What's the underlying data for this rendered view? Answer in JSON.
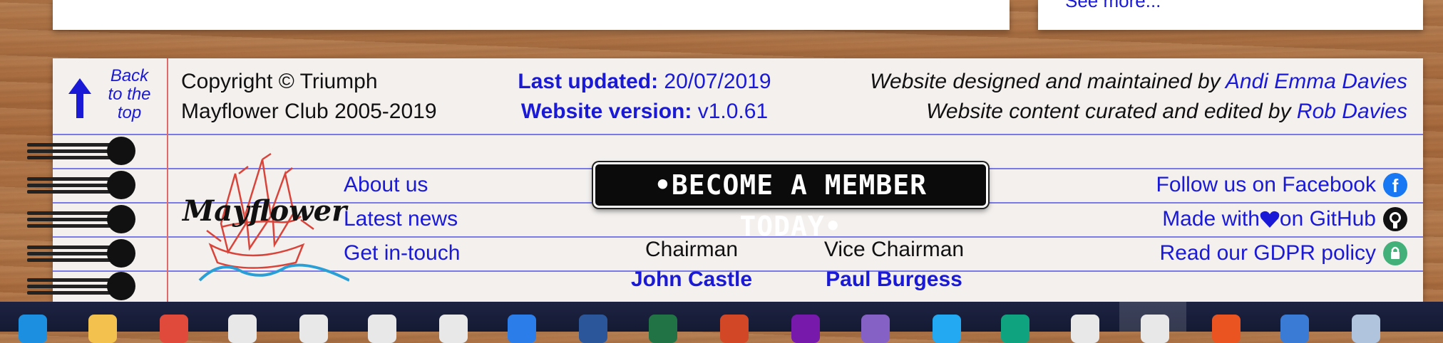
{
  "top_cards": {
    "see_more": "See more..."
  },
  "footer": {
    "back_to_top": {
      "line1": "Back",
      "line2": "to the",
      "line3": "top"
    },
    "copyright": {
      "line1": "Copyright © Triumph",
      "line2": "Mayflower Club 2005-2019"
    },
    "last_updated": {
      "label": "Last updated:",
      "value": "20/07/2019"
    },
    "website_version": {
      "label": "Website version:",
      "value": "v1.0.61"
    },
    "credits": {
      "designed_prefix": "Website designed and maintained by ",
      "designed_name": "Andi Emma Davies",
      "content_prefix": "Website content curated and edited by ",
      "content_name": "Rob Davies"
    },
    "logo_text": "Mayflower",
    "nav_links": [
      "About us",
      "Latest news",
      "Get in-touch"
    ],
    "member_button": "•BECOME A MEMBER TODAY•",
    "officers": {
      "chairman_title": "Chairman",
      "chairman_name": "John Castle",
      "vice_title": "Vice Chairman",
      "vice_name": "Paul Burgess"
    },
    "social": {
      "facebook": "Follow us on Facebook",
      "github_prefix": "Made with ",
      "github_suffix": " on GitHub",
      "gdpr": "Read our GDPR policy"
    }
  },
  "taskbar": {
    "icons": [
      "edge-icon",
      "file-explorer-icon",
      "store-icon",
      "mail-icon",
      "calendar-icon",
      "groove-icon",
      "settings-icon",
      "todo-icon",
      "word-icon",
      "excel-icon",
      "powerpoint-icon",
      "onenote-icon",
      "visual-studio-icon",
      "vscode-icon",
      "email-client-icon",
      "git-icon",
      "chrome-icon",
      "ubuntu-icon",
      "terminal-icon",
      "notepad-icon"
    ],
    "colors": [
      "#1c8fe0",
      "#f2c14e",
      "#e04a3a",
      "#e8e8e8",
      "#e8e8e8",
      "#e8e8e8",
      "#e8e8e8",
      "#2b7de9",
      "#2b579a",
      "#217346",
      "#d24726",
      "#7719aa",
      "#8661c5",
      "#23a9f2",
      "#10a37f",
      "#e8e8e8",
      "#e8e8e8",
      "#e95420",
      "#3a7bd5",
      "#b0c4de"
    ]
  }
}
